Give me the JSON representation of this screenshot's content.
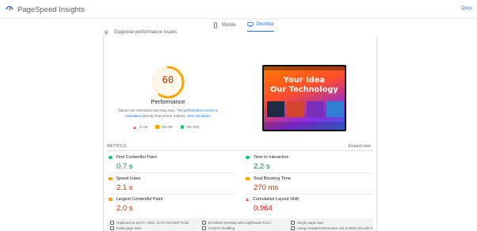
{
  "header": {
    "title": "PageSpeed Insights",
    "docs_link": "Docs"
  },
  "tabs": [
    {
      "label": "Mobile",
      "icon": "phone-icon",
      "active": false
    },
    {
      "label": "Desktop",
      "icon": "monitor-icon",
      "active": true
    }
  ],
  "diagnose": {
    "label": "Diagnose performance issues"
  },
  "score": {
    "value": 60,
    "fraction": 0.6,
    "color": "#ffa400",
    "title": "Performance",
    "note_prefix": "Values are estimated and may vary. The ",
    "note_link1": "performance score is calculated",
    "note_mid": " directly from these metrics. ",
    "note_link2": "See calculator."
  },
  "legend": [
    {
      "range": "0–49",
      "shape": "triangle",
      "color": "#ff4e42"
    },
    {
      "range": "50–89",
      "shape": "square",
      "color": "#ffa400"
    },
    {
      "range": "90–100",
      "shape": "circle",
      "color": "#0cce6b"
    }
  ],
  "screenshot": {
    "line1": "Your Idea",
    "line2": "Our Technology"
  },
  "metrics_section": {
    "label": "METRICS",
    "expand": "Expand view"
  },
  "metrics": [
    {
      "name": "First Contentful Paint",
      "value": "0.7 s",
      "status": "good"
    },
    {
      "name": "Time to Interactive",
      "value": "2.2 s",
      "status": "good"
    },
    {
      "name": "Speed Index",
      "value": "2.1 s",
      "status": "average"
    },
    {
      "name": "Total Blocking Time",
      "value": "270 ms",
      "status": "average"
    },
    {
      "name": "Largest Contentful Paint",
      "value": "2.0 s",
      "status": "average"
    },
    {
      "name": "Cumulative Layout Shift",
      "value": "0.964",
      "status": "poor"
    }
  ],
  "footer": {
    "captured": "Captured at Jul 27, 2022, 11:27 AM GMT+5:30",
    "emulated": "Emulated Desktop with Lighthouse 9.6.2",
    "single_load": "Single page load",
    "initial_load": "Initial page load",
    "throttling": "Custom throttling",
    "browser": "Using HeadlessChromium 102.0.5005.115 with lr"
  }
}
